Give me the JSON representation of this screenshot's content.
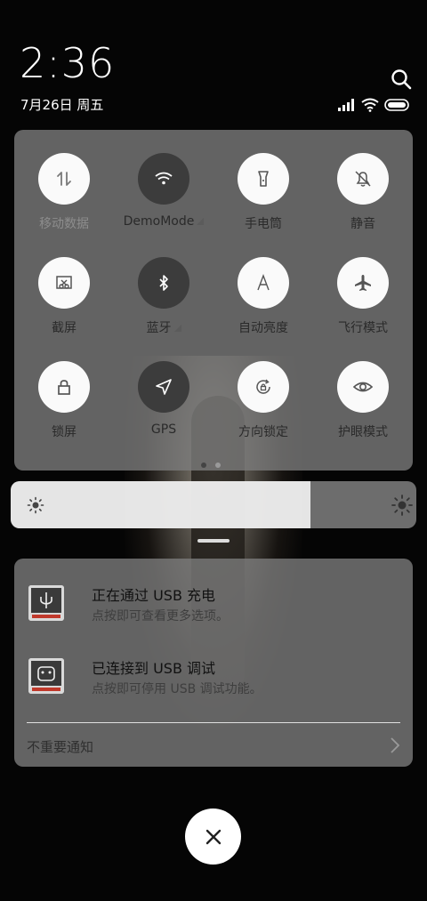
{
  "status": {
    "time": "2:36",
    "date": "7月26日 周五"
  },
  "quick_settings": {
    "tiles": [
      {
        "label": "移动数据",
        "icon": "mobile-data-icon",
        "state": "disabled"
      },
      {
        "label": "DemoMode",
        "icon": "wifi-icon",
        "state": "on",
        "expandable": true
      },
      {
        "label": "手电筒",
        "icon": "flashlight-icon",
        "state": "off"
      },
      {
        "label": "静音",
        "icon": "mute-bell-icon",
        "state": "off"
      },
      {
        "label": "截屏",
        "icon": "screenshot-icon",
        "state": "off"
      },
      {
        "label": "蓝牙",
        "icon": "bluetooth-icon",
        "state": "on",
        "expandable": true
      },
      {
        "label": "自动亮度",
        "icon": "auto-brightness-icon",
        "state": "off"
      },
      {
        "label": "飞行模式",
        "icon": "airplane-icon",
        "state": "off"
      },
      {
        "label": "锁屏",
        "icon": "lock-icon",
        "state": "off"
      },
      {
        "label": "GPS",
        "icon": "gps-icon",
        "state": "on"
      },
      {
        "label": "方向锁定",
        "icon": "rotation-lock-icon",
        "state": "off"
      },
      {
        "label": "护眼模式",
        "icon": "eye-icon",
        "state": "off"
      }
    ],
    "page_count": 2,
    "current_page": 1
  },
  "brightness": {
    "level": 0.74
  },
  "notifications": {
    "items": [
      {
        "title": "正在通过 USB 充电",
        "subtitle": "点按即可查看更多选项。",
        "icon": "usb-icon"
      },
      {
        "title": "已连接到 USB 调试",
        "subtitle": "点按即可停用 USB 调试功能。",
        "icon": "android-debug-icon"
      }
    ],
    "unimportant_label": "不重要通知"
  },
  "colors": {
    "tile_on": "#3c3c3c",
    "tile_off": "#fafafa",
    "panel": "#7d7d7d"
  }
}
